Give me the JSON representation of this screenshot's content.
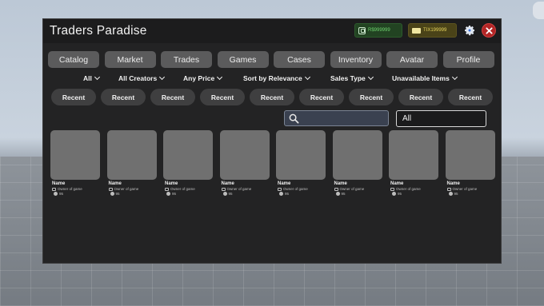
{
  "window": {
    "title": "Traders Paradise",
    "robux_label": "R$999999",
    "tix_label": "TIX199999",
    "colors": {
      "panel": "#232324",
      "close": "#b22525",
      "robux": "#6fd46f",
      "tix": "#e6d55c"
    }
  },
  "tabs": [
    "Catalog",
    "Market",
    "Trades",
    "Games",
    "Cases",
    "Inventory",
    "Avatar",
    "Profile"
  ],
  "filters": [
    "All",
    "All Creators",
    "Any Price",
    "Sort by Relevance",
    "Sales Type",
    "Unavailable Items"
  ],
  "recent_chips": [
    "Recent",
    "Recent",
    "Recent",
    "Recent",
    "Recent",
    "Recent",
    "Recent",
    "Recent",
    "Recent"
  ],
  "search": {
    "placeholder": "",
    "category_value": "All"
  },
  "items": [
    {
      "name": "Name",
      "owner": "Owner of game",
      "price": "95"
    },
    {
      "name": "Name",
      "owner": "Owner of game",
      "price": "95"
    },
    {
      "name": "Name",
      "owner": "Owner of game",
      "price": "95"
    },
    {
      "name": "Name",
      "owner": "Owner of game",
      "price": "95"
    },
    {
      "name": "Name",
      "owner": "Owner of game",
      "price": "95"
    },
    {
      "name": "Name",
      "owner": "Owner of game",
      "price": "95"
    },
    {
      "name": "Name",
      "owner": "Owner of game",
      "price": "95"
    },
    {
      "name": "Name",
      "owner": "Owner of game",
      "price": "95"
    }
  ]
}
